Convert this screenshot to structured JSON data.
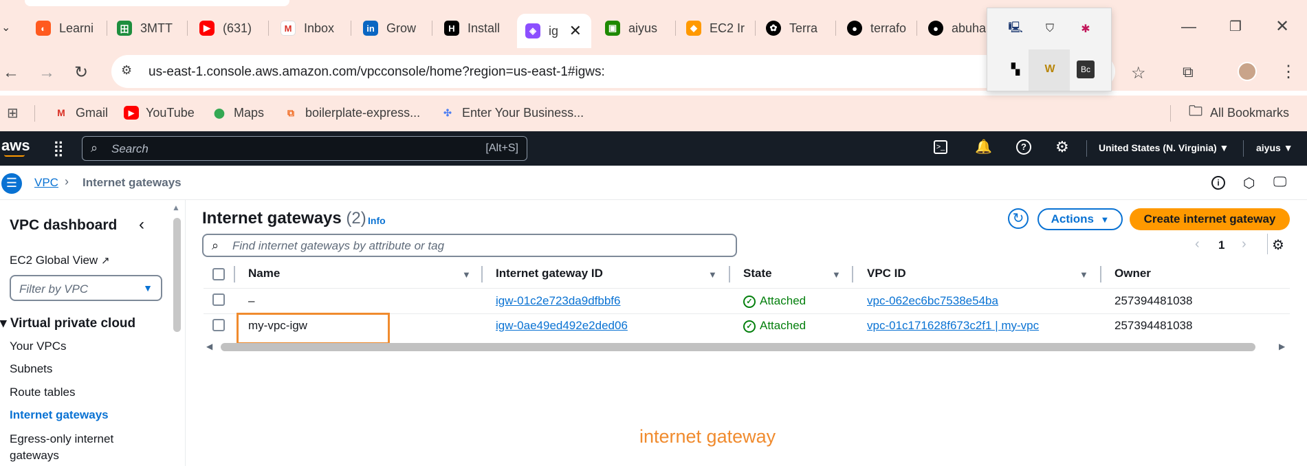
{
  "browser": {
    "tabs": [
      {
        "label": "Learni",
        "icon": "learning-icon",
        "color": "#ff5a1f"
      },
      {
        "label": "3MTT",
        "icon": "3mtt-icon",
        "color": "#1e8e3e"
      },
      {
        "label": "(631)",
        "icon": "youtube-icon",
        "color": "#ff0000"
      },
      {
        "label": "Inbox",
        "icon": "gmail-icon",
        "color": "#d93025"
      },
      {
        "label": "Grow",
        "icon": "linkedin-icon",
        "color": "#0a66c2"
      },
      {
        "label": "Install",
        "icon": "hashicorp-icon",
        "color": "#000000"
      },
      {
        "label": "ig",
        "icon": "vpc-icon",
        "color": "#8c4fff"
      },
      {
        "label": "aiyus",
        "icon": "aws-service-icon",
        "color": "#1e8900"
      },
      {
        "label": "EC2 Ir",
        "icon": "ec2-icon",
        "color": "#ff9900"
      },
      {
        "label": "Terra",
        "icon": "chatgpt-icon",
        "color": "#000000"
      },
      {
        "label": "terrafo",
        "icon": "github-icon",
        "color": "#000000"
      },
      {
        "label": "abuha",
        "icon": "github-icon",
        "color": "#000000"
      }
    ],
    "url": "us-east-1.console.aws.amazon.com/vpcconsole/home?region=us-east-1#igws:",
    "bookmarks": [
      "Gmail",
      "YouTube",
      "Maps",
      "boilerplate-express...",
      "Enter Your Business..."
    ],
    "all_bookmarks": "All Bookmarks"
  },
  "aws": {
    "logo": "aws",
    "search_placeholder": "Search",
    "search_shortcut": "[Alt+S]",
    "region": "United States (N. Virginia)",
    "user": "aiyus"
  },
  "breadcrumb": {
    "root": "VPC",
    "current": "Internet gateways"
  },
  "sidebar": {
    "title": "VPC dashboard",
    "ec2_global": "EC2 Global View",
    "filter_placeholder": "Filter by VPC",
    "section": "Virtual private cloud",
    "items": [
      "Your VPCs",
      "Subnets",
      "Route tables",
      "Internet gateways",
      "Egress-only internet gateways"
    ],
    "active_item": "Internet gateways"
  },
  "main": {
    "title": "Internet gateways",
    "count": "(2)",
    "info": "Info",
    "actions": "Actions",
    "create": "Create internet gateway",
    "find_placeholder": "Find internet gateways by attribute or tag",
    "page": "1",
    "columns": [
      "Name",
      "Internet gateway ID",
      "State",
      "VPC ID",
      "Owner"
    ],
    "rows": [
      {
        "name": "–",
        "id": "igw-01c2e723da9dfbbf6",
        "state": "Attached",
        "vpc": "vpc-062ec6bc7538e54ba",
        "owner": "257394481038"
      },
      {
        "name": "my-vpc-igw",
        "id": "igw-0ae49ed492e2ded06",
        "state": "Attached",
        "vpc": "vpc-01c171628f673c2f1 | my-vpc",
        "owner": "257394481038"
      }
    ],
    "annotation": "internet gateway"
  },
  "colors": {
    "accent": "#0972d3",
    "create_button": "#ff9900",
    "annotation": "#f08b2e",
    "success": "#037f0c"
  }
}
